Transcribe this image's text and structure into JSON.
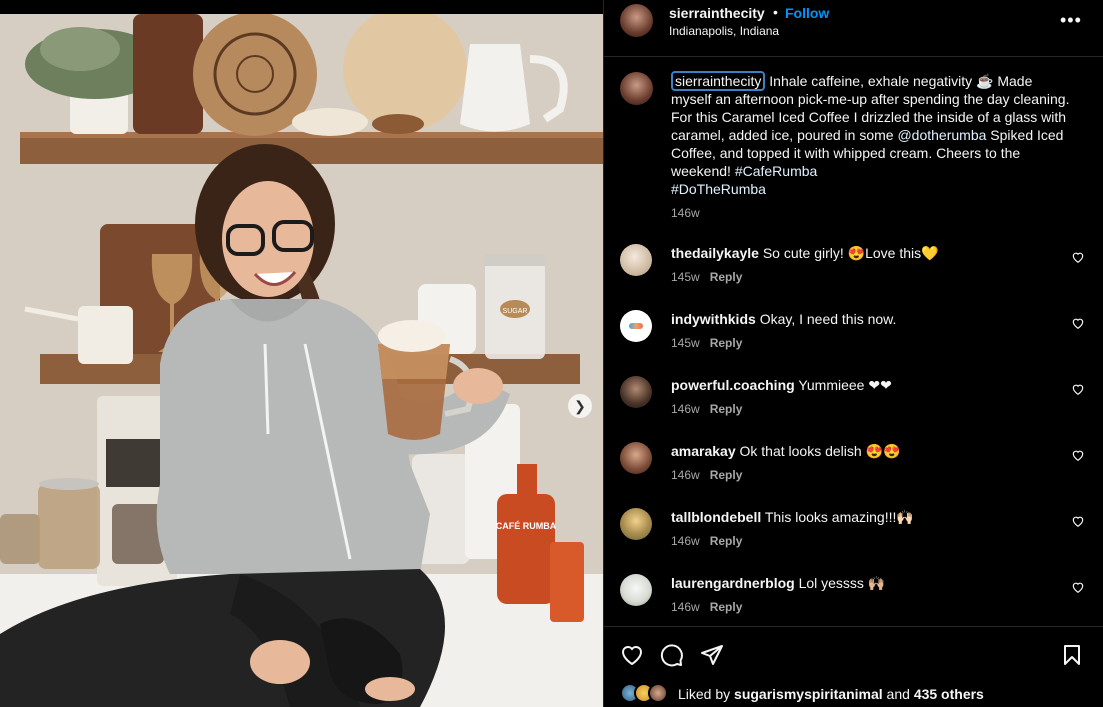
{
  "header": {
    "username": "sierrainthecity",
    "dot": "•",
    "follow_label": "Follow",
    "location": "Indianapolis, Indiana",
    "more_label": "•••"
  },
  "caption": {
    "username": "sierrainthecity",
    "text_1": " Inhale caffeine, exhale negativity ☕ Made myself an afternoon pick-me-up after spending the day cleaning. For this Caramel Iced Coffee I drizzled the inside of a glass with caramel, added ice, poured in some ",
    "mention": "@dotherumba",
    "text_2": " Spiked Iced Coffee, and topped it with whipped cream. Cheers to the weekend! ",
    "hashtag_1": "#CafeRumba",
    "hashtag_2": "#DoTheRumba",
    "time": "146w"
  },
  "comments": [
    {
      "username": "thedailykayle",
      "text": "So cute girly! 😍Love this💛",
      "time": "145w",
      "reply": "Reply"
    },
    {
      "username": "indywithkids",
      "text": "Okay, I need this now.",
      "time": "145w",
      "reply": "Reply"
    },
    {
      "username": "powerful.coaching",
      "text": "Yummieee ❤❤",
      "time": "146w",
      "reply": "Reply"
    },
    {
      "username": "amarakay",
      "text": "Ok that looks delish 😍😍",
      "time": "146w",
      "reply": "Reply"
    },
    {
      "username": "tallblondebell",
      "text": "This looks amazing!!!🙌🏻",
      "time": "146w",
      "reply": "Reply"
    },
    {
      "username": "laurengardnerblog",
      "text": "Lol yessss 🙌🏼",
      "time": "146w",
      "reply": "Reply"
    }
  ],
  "likes": {
    "prefix": "Liked by ",
    "user": "sugarismyspiritanimal",
    "middle": " and ",
    "others": "435 others"
  },
  "photo_labels": {
    "jar_label": "SUGAR",
    "bottle_label": "CAFÉ RUMBA",
    "can_label": "CAFÉ RUMBA"
  },
  "colors": {
    "accent": "#0095f6",
    "background": "#000000",
    "text": "#f5f5f5",
    "muted": "#a8a8a8"
  }
}
